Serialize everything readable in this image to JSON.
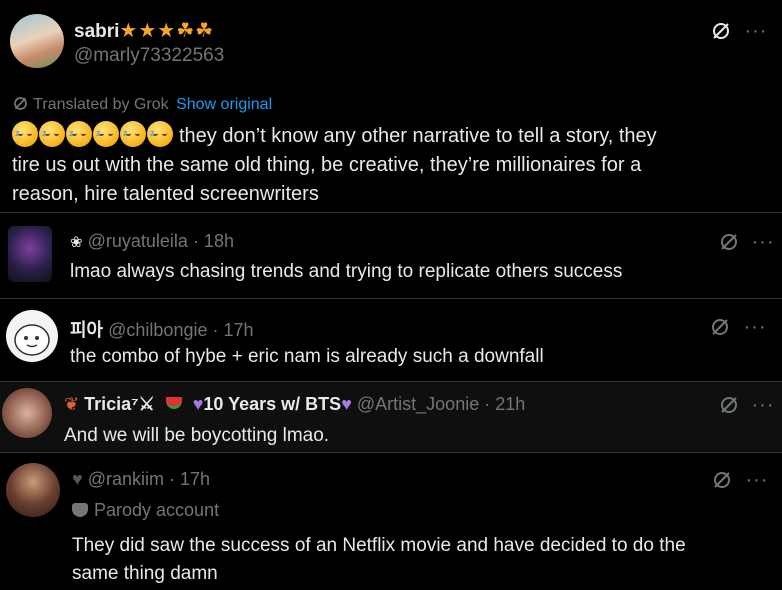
{
  "main_post": {
    "display_name": "sabri",
    "badges": "★★★☘☘",
    "handle": "@marly73322563",
    "translated_label": "Translated by Grok",
    "show_original": "Show original",
    "text_line1": "they don’t know any other narrative to tell a story, they",
    "text_line2": "tire us out with the same old thing, be creative, they’re millionaires for a",
    "text_line3": "reason, hire talented screenwriters"
  },
  "replies": [
    {
      "prefix": "❀",
      "handle": "@ruyatuleila",
      "time": "· 18h",
      "text": "lmao always chasing trends and trying to replicate others success"
    },
    {
      "display_name": "피아",
      "handle": "@chilbongie",
      "time": "· 17h",
      "text": "the combo of hybe + eric nam is already such a downfall"
    },
    {
      "display_name": "Tricia⁷⚔",
      "extra": "10 Years w/ BTS",
      "handle": "@Artist_Joonie",
      "time": "· 21h",
      "text": "And we will be boycotting lmao."
    },
    {
      "handle": "@rankiim",
      "time": "· 17h",
      "parody_label": "Parody account",
      "text_line1": "They did saw the success of an Netflix movie and have decided to do the",
      "text_line2": "same thing damn"
    }
  ],
  "icons": {
    "more": "···",
    "grok_translate": "slashed-circle-icon"
  }
}
